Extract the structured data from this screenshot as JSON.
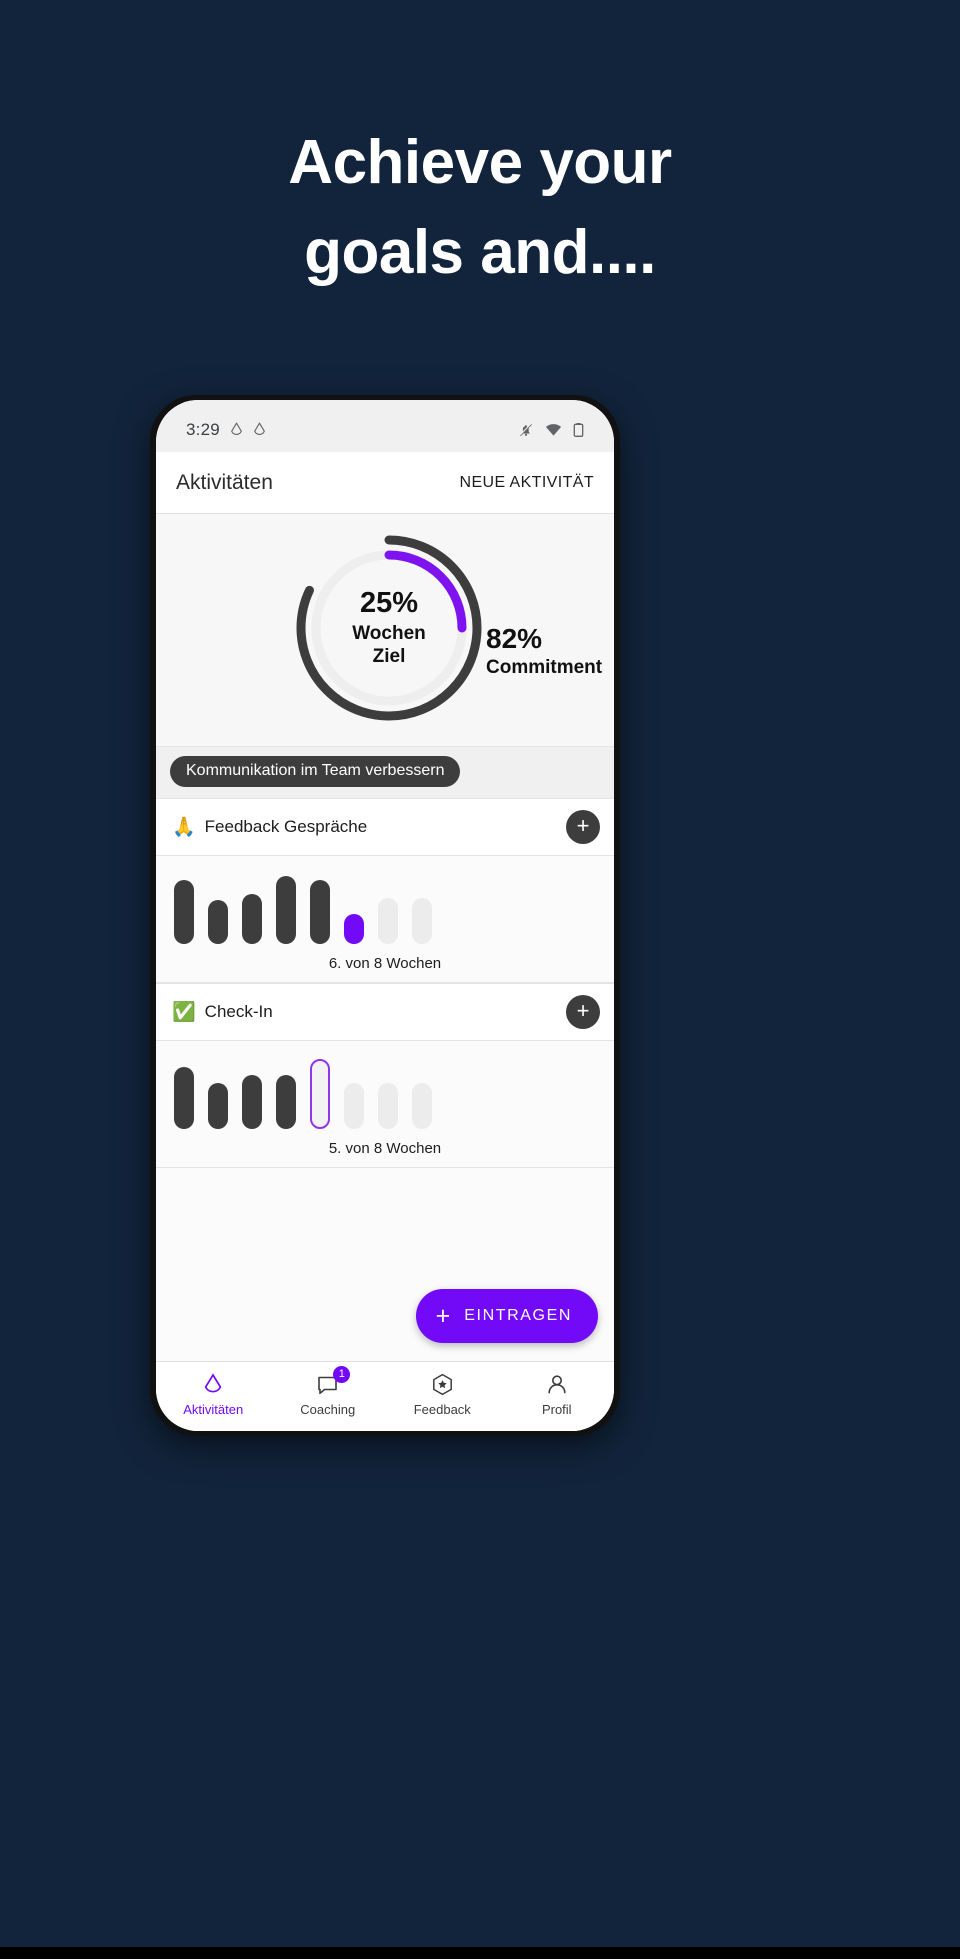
{
  "headline": {
    "line1": "Achieve your",
    "line2": "goals and...."
  },
  "colors": {
    "background": "#12243c",
    "accent": "#7209f7",
    "dark": "#3d3d3d",
    "empty": "#ececec"
  },
  "phone": {
    "statusbar": {
      "time": "3:29",
      "left_icons": [
        "drop-icon",
        "drop-icon"
      ],
      "right_icons": [
        "bell-muted-icon",
        "wifi-icon",
        "battery-icon"
      ]
    },
    "appbar": {
      "title": "Aktivitäten",
      "action": "NEUE AKTIVITÄT"
    },
    "summary": {
      "week_goal_percent": "25%",
      "week_goal_label_line1": "Wochen",
      "week_goal_label_line2": "Ziel",
      "commitment_percent": "82%",
      "commitment_label": "Commitment"
    },
    "goal_chip": "Kommunikation im Team verbessern",
    "activities": [
      {
        "emoji": "🙏",
        "emoji_name": "praying-hands-icon",
        "name": "Feedback Gespräche",
        "add_label": "+",
        "caption": "6. von 8 Wochen"
      },
      {
        "emoji": "✅",
        "emoji_name": "check-mark-icon",
        "name": "Check-In",
        "add_label": "+",
        "caption": "5. von 8 Wochen"
      }
    ],
    "fab": {
      "plus": "+",
      "label": "EINTRAGEN"
    },
    "bottomnav": [
      {
        "label": "Aktivitäten",
        "icon": "drop-icon",
        "active": true,
        "badge": null
      },
      {
        "label": "Coaching",
        "icon": "chat-bubble-icon",
        "active": false,
        "badge": "1"
      },
      {
        "label": "Feedback",
        "icon": "star-badge-icon",
        "active": false,
        "badge": null
      },
      {
        "label": "Profil",
        "icon": "person-icon",
        "active": false,
        "badge": null
      }
    ]
  },
  "chart_data": [
    {
      "type": "bar",
      "title": "Feedback Gespräche",
      "categories": [
        "1",
        "2",
        "3",
        "4",
        "5",
        "6",
        "7",
        "8"
      ],
      "values": [
        64,
        44,
        50,
        68,
        64,
        30,
        46,
        46
      ],
      "states": [
        "done",
        "done",
        "done",
        "done",
        "done",
        "current-fill",
        "empty",
        "empty"
      ],
      "xlabel": "Wochen",
      "ylabel": "",
      "annotation": "6. von 8 Wochen",
      "weeks_total": 8,
      "weeks_current": 6
    },
    {
      "type": "bar",
      "title": "Check-In",
      "categories": [
        "1",
        "2",
        "3",
        "4",
        "5",
        "6",
        "7",
        "8"
      ],
      "values": [
        62,
        46,
        54,
        54,
        70,
        46,
        46,
        46
      ],
      "states": [
        "done",
        "done",
        "done",
        "done",
        "current-outline",
        "empty",
        "empty",
        "empty"
      ],
      "xlabel": "Wochen",
      "ylabel": "",
      "annotation": "5. von 8 Wochen",
      "weeks_total": 8,
      "weeks_current": 5
    },
    {
      "type": "pie",
      "title": "Wochen Ziel / Commitment",
      "series": [
        {
          "name": "Wochen Ziel",
          "value": 25,
          "color": "#7209f7"
        },
        {
          "name": "Commitment",
          "value": 82,
          "color": "#3d3d3d"
        }
      ],
      "units": "percent"
    }
  ]
}
